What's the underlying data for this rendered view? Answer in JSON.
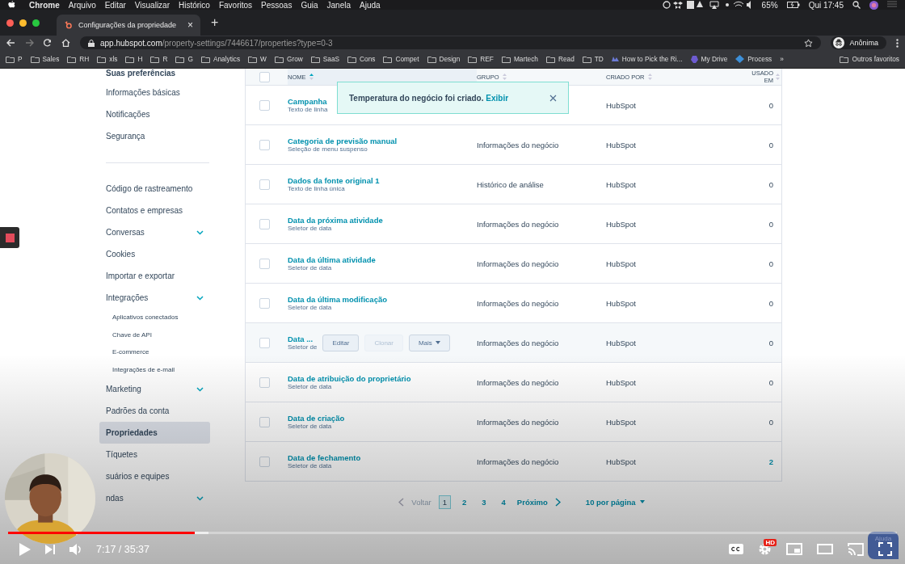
{
  "menu_bar": {
    "app": "Chrome",
    "items": [
      "Arquivo",
      "Editar",
      "Visualizar",
      "Histórico",
      "Favoritos",
      "Pessoas",
      "Guia",
      "Janela",
      "Ajuda"
    ],
    "battery": "65%",
    "clock": "Qui 17:45"
  },
  "browser": {
    "tab": {
      "title": "Configurações da propriedade",
      "close": "×"
    },
    "new_tab": "+",
    "url_host": "app.hubspot.com",
    "url_path": "/property-settings/7446617/properties?type=0-3",
    "profile": "Anônima",
    "bookmarks": [
      {
        "label": "P",
        "kind": "folder"
      },
      {
        "label": "Sales",
        "kind": "folder"
      },
      {
        "label": "RH",
        "kind": "folder"
      },
      {
        "label": "xls",
        "kind": "folder"
      },
      {
        "label": "H",
        "kind": "folder"
      },
      {
        "label": "R",
        "kind": "folder"
      },
      {
        "label": "G",
        "kind": "folder"
      },
      {
        "label": "Analytics",
        "kind": "folder"
      },
      {
        "label": "W",
        "kind": "folder"
      },
      {
        "label": "Grow",
        "kind": "folder"
      },
      {
        "label": "SaaS",
        "kind": "folder"
      },
      {
        "label": "Cons",
        "kind": "folder"
      },
      {
        "label": "Compet",
        "kind": "folder"
      },
      {
        "label": "Design",
        "kind": "folder"
      },
      {
        "label": "REF",
        "kind": "folder"
      },
      {
        "label": "Martech",
        "kind": "folder"
      },
      {
        "label": "Read",
        "kind": "folder"
      },
      {
        "label": "TD",
        "kind": "folder"
      },
      {
        "label": "How to Pick the Ri...",
        "kind": "page"
      },
      {
        "label": "My Drive",
        "kind": "drive"
      },
      {
        "label": "Process",
        "kind": "app"
      }
    ],
    "bookmarks_more": "»",
    "other_bookmarks": "Outros favoritos"
  },
  "sidebar": {
    "items": [
      {
        "label": "Suas preferências",
        "kind": "heading",
        "selected": false
      },
      {
        "label": "Informações básicas",
        "kind": "item",
        "selected": false
      },
      {
        "label": "Notificações",
        "kind": "item",
        "selected": false
      },
      {
        "label": "Segurança",
        "kind": "item",
        "selected": false
      },
      {
        "kind": "divider"
      },
      {
        "label": "Código de rastreamento",
        "kind": "item",
        "selected": false
      },
      {
        "label": "Contatos e empresas",
        "kind": "item",
        "selected": false
      },
      {
        "label": "Conversas",
        "kind": "item",
        "selected": false,
        "expandable": true
      },
      {
        "label": "Cookies",
        "kind": "item",
        "selected": false
      },
      {
        "label": "Importar e exportar",
        "kind": "item",
        "selected": false
      },
      {
        "label": "Integrações",
        "kind": "item",
        "selected": false,
        "expandable": true
      },
      {
        "label": "Aplicativos conectados",
        "kind": "sub",
        "selected": false
      },
      {
        "label": "Chave de API",
        "kind": "sub",
        "selected": false
      },
      {
        "label": "E-commerce",
        "kind": "sub",
        "selected": false
      },
      {
        "label": "Integrações de e-mail",
        "kind": "sub",
        "selected": false
      },
      {
        "label": "Marketing",
        "kind": "item",
        "selected": false,
        "expandable": true
      },
      {
        "label": "Padrões da conta",
        "kind": "item",
        "selected": false
      },
      {
        "label": "Propriedades",
        "kind": "item",
        "selected": true
      },
      {
        "label": "Tíquetes",
        "kind": "item",
        "selected": false
      },
      {
        "label": "suários e equipes",
        "kind": "item",
        "selected": false
      },
      {
        "label": "ndas",
        "kind": "item",
        "selected": false,
        "expandable": true
      }
    ]
  },
  "table": {
    "select_all_checked": false,
    "columns": [
      "NOME",
      "GRUPO",
      "CRIADO POR",
      "USADO EM"
    ],
    "rows": [
      {
        "name": "Campanha",
        "type": "Texto de linha",
        "creator": "HubSpot",
        "used": "0",
        "kind": "plain",
        "used_link": false
      },
      {
        "name": "Categoria de previsão manual",
        "type": "Seleção de menu suspenso",
        "group": "Informações do negócio",
        "creator": "HubSpot",
        "used": "0",
        "kind": "plain",
        "used_link": false
      },
      {
        "name": "Dados da fonte original 1",
        "type": "Texto de linha única",
        "group": "Histórico de análise",
        "creator": "HubSpot",
        "used": "0",
        "kind": "plain",
        "used_link": false
      },
      {
        "name": "Data da próxima atividade",
        "type": "Seletor de data",
        "group": "Informações do negócio",
        "creator": "HubSpot",
        "used": "0",
        "kind": "plain",
        "used_link": false
      },
      {
        "name": "Data da última atividade",
        "type": "Seletor de data",
        "group": "Informações do negócio",
        "creator": "HubSpot",
        "used": "0",
        "kind": "plain",
        "used_link": false
      },
      {
        "name": "Data da última modificação",
        "type": "Seletor de data",
        "group": "Informações do negócio",
        "creator": "HubSpot",
        "used": "0",
        "kind": "plain",
        "used_link": false
      },
      {
        "name": "Data ...",
        "type": "Seletor de",
        "group": "Informações do negócio",
        "creator": "HubSpot",
        "used": "0",
        "kind": "hover",
        "used_link": false,
        "actions": [
          {
            "label": "Editar",
            "disabled": false
          },
          {
            "label": "Clonar",
            "disabled": true
          },
          {
            "label": "Mais",
            "disabled": false,
            "caret": true
          }
        ]
      },
      {
        "name": "Data de atribuição do proprietário",
        "type": "Seletor de data",
        "group": "Informações do negócio",
        "creator": "HubSpot",
        "used": "0",
        "kind": "plain",
        "used_link": false
      },
      {
        "name": "Data de criação",
        "type": "Seletor de data",
        "group": "Informações do negócio",
        "creator": "HubSpot",
        "used": "0",
        "kind": "plain",
        "used_link": false
      },
      {
        "name": "Data de fechamento",
        "type": "Seletor de data",
        "group": "Informações do negócio",
        "creator": "HubSpot",
        "used": "2",
        "kind": "plain",
        "used_link": true
      }
    ]
  },
  "toast": {
    "message": "Temperatura do negócio foi criado.",
    "link": "Exibir"
  },
  "pagination": {
    "prev": "Voltar",
    "prev_disabled": true,
    "pages": [
      {
        "label": "1",
        "selected": true
      },
      {
        "label": "2",
        "selected": false
      },
      {
        "label": "3",
        "selected": false
      },
      {
        "label": "4",
        "selected": false
      }
    ],
    "next": "Próximo",
    "per_page": "10 por página"
  },
  "help_button": "Ajuda",
  "player": {
    "level": 0.21,
    "time": "7:17 / 35:37",
    "quality_badge": "HD"
  }
}
